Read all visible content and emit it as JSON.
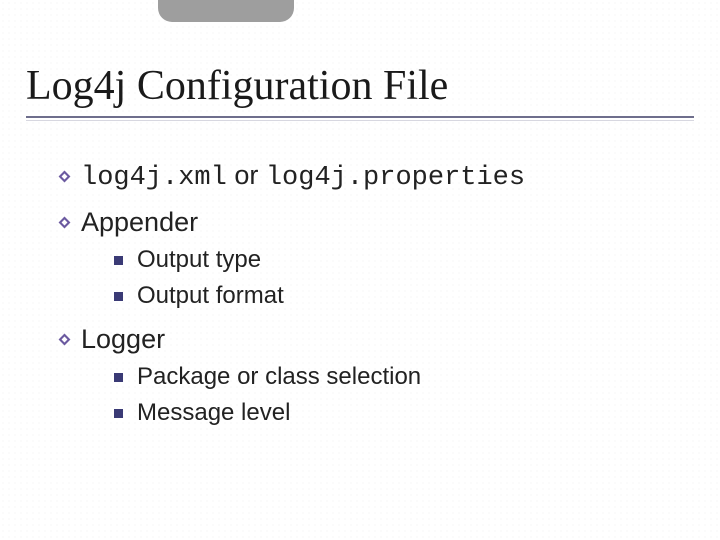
{
  "title": "Log4j Configuration File",
  "bullets": {
    "b1": {
      "code1": "log4j.xml",
      "join": " or ",
      "code2": "log4j.properties"
    },
    "b2": {
      "label": "Appender",
      "sub": [
        "Output type",
        "Output format"
      ]
    },
    "b3": {
      "label": "Logger",
      "sub": [
        "Package or class selection",
        "Message level"
      ]
    }
  },
  "colors": {
    "accent": "#5a4a8a",
    "bullet_square": "#3a3a75"
  }
}
